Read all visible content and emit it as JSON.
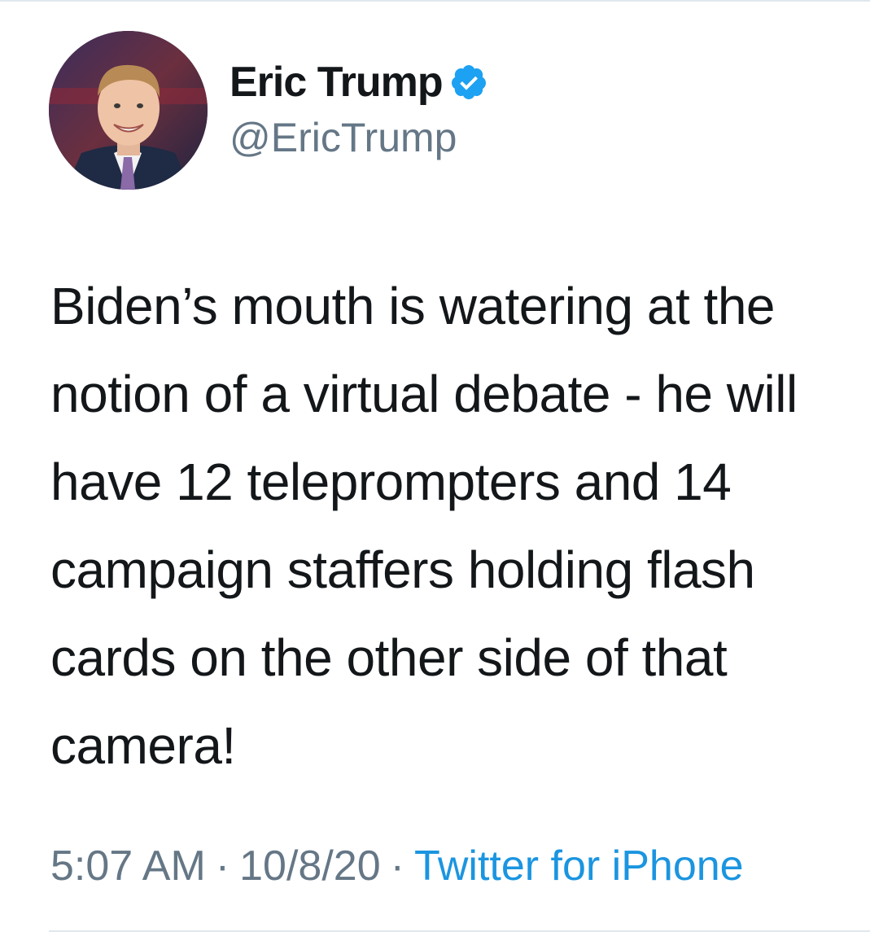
{
  "tweet": {
    "author": {
      "display_name": "Eric Trump",
      "handle": "@EricTrump",
      "verified_icon": "verified-badge-icon",
      "avatar_icon": "profile-photo"
    },
    "text_lines": [
      "Biden’s mouth is watering at the",
      "notion of a virtual debate - he will",
      "have 12 teleprompters and 14",
      "campaign staffers holding flash",
      "cards on the other side of that",
      "camera!"
    ],
    "time": "5:07 AM",
    "date": "10/8/20",
    "separator": "·",
    "source": "Twitter for iPhone"
  },
  "colors": {
    "text": "#14171a",
    "secondary": "#657786",
    "link": "#1b95e0",
    "verified": "#1da1f2",
    "divider": "#e1e8ed"
  }
}
